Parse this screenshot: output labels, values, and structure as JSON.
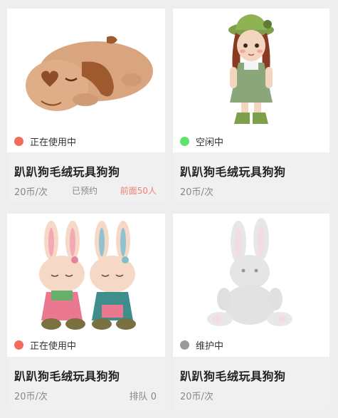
{
  "colors": {
    "in_use": "#f26b5b",
    "idle": "#5fe26e",
    "maintenance": "#9a9a9a",
    "accent_red": "#f08070"
  },
  "cards": [
    {
      "image_icon": "plush-dog-icon",
      "status": "正在使用中",
      "title": "趴趴狗毛绒玩具狗狗",
      "price": "20币/次",
      "reserved": "已预约",
      "ahead": "前面50人"
    },
    {
      "image_icon": "doll-icon",
      "status": "空闲中",
      "title": "趴趴狗毛绒玩具狗狗",
      "price": "20币/次"
    },
    {
      "image_icon": "bunny-pair-icon",
      "status": "正在使用中",
      "title": "趴趴狗毛绒玩具狗狗",
      "price": "20币/次",
      "queue": "排队 0"
    },
    {
      "image_icon": "bunny-icon",
      "status": "维护中",
      "title": "趴趴狗毛绒玩具狗狗",
      "price": "20币/次"
    }
  ]
}
